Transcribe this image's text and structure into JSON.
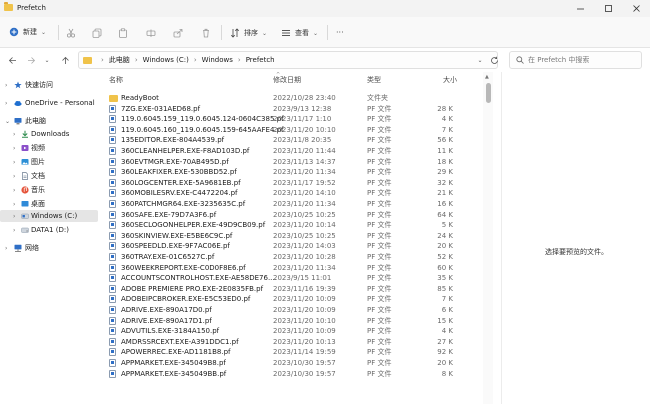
{
  "window": {
    "title": "Prefetch"
  },
  "toolbar": {
    "new_label": "新建",
    "sort_label": "排序",
    "view_label": "查看",
    "more": "···"
  },
  "address": {
    "segments": [
      "此电脑",
      "Windows (C:)",
      "Windows",
      "Prefetch"
    ]
  },
  "search": {
    "placeholder": "在 Prefetch 中搜索"
  },
  "sidebar": {
    "items": [
      {
        "label": "快速访问",
        "icon": "star-icon"
      },
      {
        "label": "OneDrive - Personal",
        "icon": "cloud-icon"
      },
      {
        "label": "此电脑",
        "icon": "computer-icon"
      },
      {
        "label": "Downloads",
        "icon": "download-icon"
      },
      {
        "label": "视频",
        "icon": "video-icon"
      },
      {
        "label": "图片",
        "icon": "picture-icon"
      },
      {
        "label": "文档",
        "icon": "document-icon"
      },
      {
        "label": "音乐",
        "icon": "music-icon"
      },
      {
        "label": "桌面",
        "icon": "desktop-icon"
      },
      {
        "label": "Windows (C:)",
        "icon": "drive-icon"
      },
      {
        "label": "DATA1 (D:)",
        "icon": "drive-icon"
      },
      {
        "label": "网络",
        "icon": "network-icon"
      }
    ]
  },
  "columns": {
    "name": "名称",
    "date": "修改日期",
    "type": "类型",
    "size": "大小"
  },
  "files": [
    {
      "name": "ReadyBoot",
      "date": "2022/10/28 23:40",
      "type": "文件夹",
      "size": "",
      "folder": true
    },
    {
      "name": "7ZG.EXE-031AED68.pf",
      "date": "2023/9/13 12:38",
      "type": "PF 文件",
      "size": "28 K"
    },
    {
      "name": "119.0.6045.159_119.0.6045.124-0604C385.pf",
      "date": "2023/11/17 1:10",
      "type": "PF 文件",
      "size": "4 K"
    },
    {
      "name": "119.0.6045.160_119.0.6045.159-645AAFE4.pf",
      "date": "2023/11/20 10:10",
      "type": "PF 文件",
      "size": "7 K"
    },
    {
      "name": "135EDITOR.EXE-804A4539.pf",
      "date": "2023/11/8 20:35",
      "type": "PF 文件",
      "size": "56 K"
    },
    {
      "name": "360CLEANHELPER.EXE-F8AD103D.pf",
      "date": "2023/11/20 11:44",
      "type": "PF 文件",
      "size": "11 K"
    },
    {
      "name": "360EVTMGR.EXE-70AB495D.pf",
      "date": "2023/11/13 14:37",
      "type": "PF 文件",
      "size": "18 K"
    },
    {
      "name": "360LEAKFIXER.EXE-530BBD52.pf",
      "date": "2023/11/20 11:34",
      "type": "PF 文件",
      "size": "29 K"
    },
    {
      "name": "360LOGCENTER.EXE-5A9681EB.pf",
      "date": "2023/11/17 19:52",
      "type": "PF 文件",
      "size": "32 K"
    },
    {
      "name": "360MOBILESRV.EXE-C4472204.pf",
      "date": "2023/11/20 14:10",
      "type": "PF 文件",
      "size": "21 K"
    },
    {
      "name": "360PATCHMGR64.EXE-3235635C.pf",
      "date": "2023/11/20 11:34",
      "type": "PF 文件",
      "size": "16 K"
    },
    {
      "name": "360SAFE.EXE-79D7A3F6.pf",
      "date": "2023/10/25 10:25",
      "type": "PF 文件",
      "size": "64 K"
    },
    {
      "name": "360SECLOGONHELPER.EXE-49D9CB09.pf",
      "date": "2023/11/20 10:14",
      "type": "PF 文件",
      "size": "5 K"
    },
    {
      "name": "360SKINVIEW.EXE-E5BE6C9C.pf",
      "date": "2023/10/25 10:25",
      "type": "PF 文件",
      "size": "24 K"
    },
    {
      "name": "360SPEEDLD.EXE-9F7AC06E.pf",
      "date": "2023/11/20 14:03",
      "type": "PF 文件",
      "size": "20 K"
    },
    {
      "name": "360TRAY.EXE-01C6527C.pf",
      "date": "2023/11/20 10:28",
      "type": "PF 文件",
      "size": "52 K"
    },
    {
      "name": "360WEEKREPORT.EXE-C0D0F8E6.pf",
      "date": "2023/11/20 11:34",
      "type": "PF 文件",
      "size": "60 K"
    },
    {
      "name": "ACCOUNTSCONTROLHOST.EXE-AE58DE76....",
      "date": "2023/9/15 11:01",
      "type": "PF 文件",
      "size": "35 K"
    },
    {
      "name": "ADOBE PREMIERE PRO.EXE-2E0835FB.pf",
      "date": "2023/11/16 19:39",
      "type": "PF 文件",
      "size": "85 K"
    },
    {
      "name": "ADOBEIPCBROKER.EXE-E5C53ED0.pf",
      "date": "2023/11/20 10:09",
      "type": "PF 文件",
      "size": "7 K"
    },
    {
      "name": "ADRIVE.EXE-890A17D0.pf",
      "date": "2023/11/20 10:09",
      "type": "PF 文件",
      "size": "6 K"
    },
    {
      "name": "ADRIVE.EXE-890A17D1.pf",
      "date": "2023/11/20 10:10",
      "type": "PF 文件",
      "size": "15 K"
    },
    {
      "name": "ADVUTILS.EXE-3184A150.pf",
      "date": "2023/11/20 10:09",
      "type": "PF 文件",
      "size": "4 K"
    },
    {
      "name": "AMDRSSRCEXT.EXE-A391DDC1.pf",
      "date": "2023/11/20 10:13",
      "type": "PF 文件",
      "size": "27 K"
    },
    {
      "name": "APOWERREC.EXE-AD1181B8.pf",
      "date": "2023/11/14 19:59",
      "type": "PF 文件",
      "size": "92 K"
    },
    {
      "name": "APPMARKET.EXE-345049B8.pf",
      "date": "2023/10/30 19:57",
      "type": "PF 文件",
      "size": "20 K"
    },
    {
      "name": "APPMARKET.EXE-345049BB.pf",
      "date": "2023/10/30 19:57",
      "type": "PF 文件",
      "size": "8 K"
    }
  ],
  "preview": {
    "message": "选择要预览的文件。"
  }
}
